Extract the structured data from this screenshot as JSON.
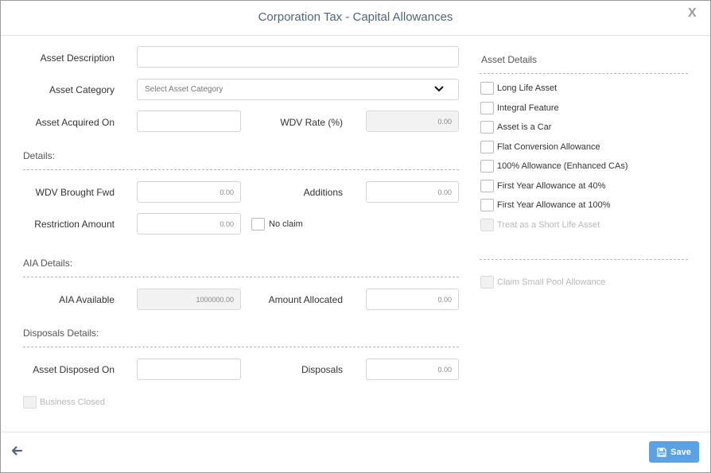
{
  "dialog": {
    "title": "Corporation Tax - Capital Allowances",
    "close_label": "X"
  },
  "form": {
    "asset_description": {
      "label": "Asset Description",
      "value": ""
    },
    "asset_category": {
      "label": "Asset Category",
      "placeholder": "Select Asset Category"
    },
    "asset_acquired_on": {
      "label": "Asset Acquired On",
      "value": ""
    },
    "wdv_rate": {
      "label": "WDV Rate (%)",
      "value": "0.00"
    },
    "details_heading": "Details:",
    "wdv_brought_fwd": {
      "label": "WDV Brought Fwd",
      "value": "0.00"
    },
    "additions": {
      "label": "Additions",
      "value": "0.00"
    },
    "restriction_amount": {
      "label": "Restriction Amount",
      "value": "0.00"
    },
    "no_claim": {
      "label": "No claim",
      "checked": false
    },
    "aia_heading": "AIA Details:",
    "aia_available": {
      "label": "AIA Available",
      "value": "1000000.00"
    },
    "amount_allocated": {
      "label": "Amount Allocated",
      "value": "0.00"
    },
    "disposals_heading": "Disposals Details:",
    "asset_disposed_on": {
      "label": "Asset Disposed On",
      "value": ""
    },
    "disposals": {
      "label": "Disposals",
      "value": "0.00"
    },
    "business_closed": {
      "label": "Business Closed",
      "checked": false,
      "disabled": true
    }
  },
  "asset_details": {
    "heading": "Asset Details",
    "options": [
      {
        "label": "Long Life Asset",
        "checked": false,
        "disabled": false
      },
      {
        "label": "Integral Feature",
        "checked": false,
        "disabled": false
      },
      {
        "label": "Asset is a Car",
        "checked": false,
        "disabled": false
      },
      {
        "label": "Flat Conversion Allowance",
        "checked": false,
        "disabled": false
      },
      {
        "label": "100% Allowance (Enhanced CAs)",
        "checked": false,
        "disabled": false
      },
      {
        "label": "First Year Allowance at 40%",
        "checked": false,
        "disabled": false
      },
      {
        "label": "First Year Allowance at 100%",
        "checked": false,
        "disabled": false
      },
      {
        "label": "Treat as a Short Life Asset",
        "checked": false,
        "disabled": true
      }
    ],
    "small_pool": {
      "label": "Claim Small Pool Allowance",
      "checked": false,
      "disabled": true
    }
  },
  "footer": {
    "back_icon": "arrow-left-icon",
    "save_label": "Save",
    "save_icon": "floppy-disk-icon"
  },
  "colors": {
    "title": "#4f6577",
    "save_button": "#5aa2e3"
  }
}
